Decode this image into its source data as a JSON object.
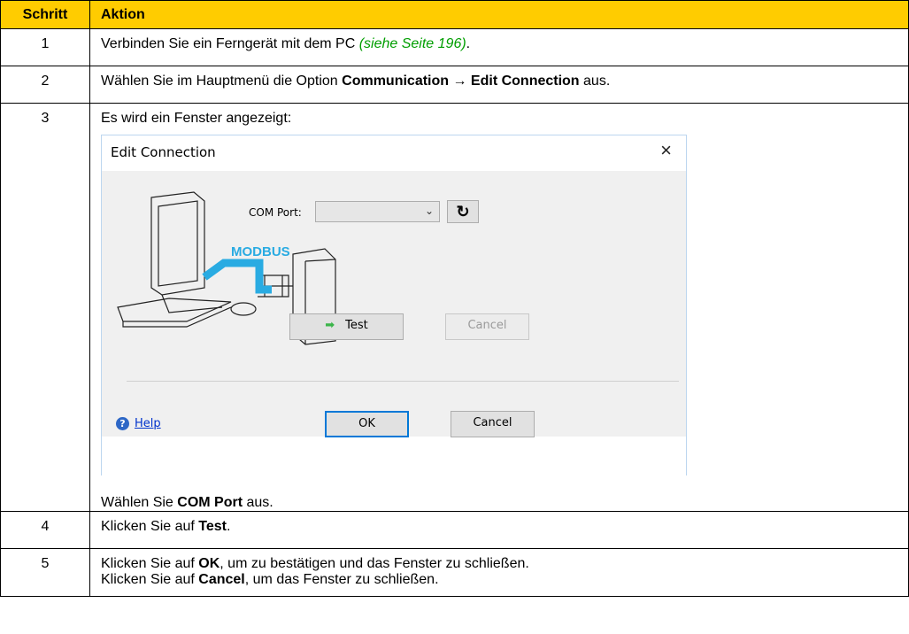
{
  "header": {
    "col1": "Schritt",
    "col2": "Aktion"
  },
  "rows": [
    {
      "num": "1",
      "pre": "Verbinden Sie ein Ferngerät mit dem PC ",
      "link": "(siehe Seite 196)",
      "post": "."
    },
    {
      "num": "2",
      "pre": "Wählen Sie im Hauptmenü die Option ",
      "menu1": "Communication",
      "arrow": " → ",
      "menu2": "Edit Connection",
      "post": " aus."
    },
    {
      "num": "3",
      "intro": "Es wird ein Fenster angezeigt:",
      "after_pre": "Wählen Sie ",
      "after_bold": "COM Port",
      "after_post": " aus."
    },
    {
      "num": "4",
      "pre": "Klicken Sie auf ",
      "bold": "Test",
      "post": "."
    },
    {
      "num": "5",
      "l1_pre": "Klicken Sie auf ",
      "l1_bold": "OK",
      "l1_post": ", um zu bestätigen und das Fenster zu schließen.",
      "l2_pre": "Klicken Sie auf ",
      "l2_bold": "Cancel",
      "l2_post": ", um das Fenster zu schließen."
    }
  ],
  "dialog": {
    "title": "Edit Connection",
    "close": "×",
    "illustration_label": "MODBUS",
    "com_port_label": "COM Port:",
    "com_port_value": "",
    "refresh_icon": "↻",
    "test_label": "Test",
    "cancel_disabled_label": "Cancel",
    "help_label": "Help",
    "ok_label": "OK",
    "cancel_label": "Cancel"
  },
  "colors": {
    "header_bg": "#ffcc00",
    "link": "#009e00",
    "modbus": "#29abe2"
  }
}
